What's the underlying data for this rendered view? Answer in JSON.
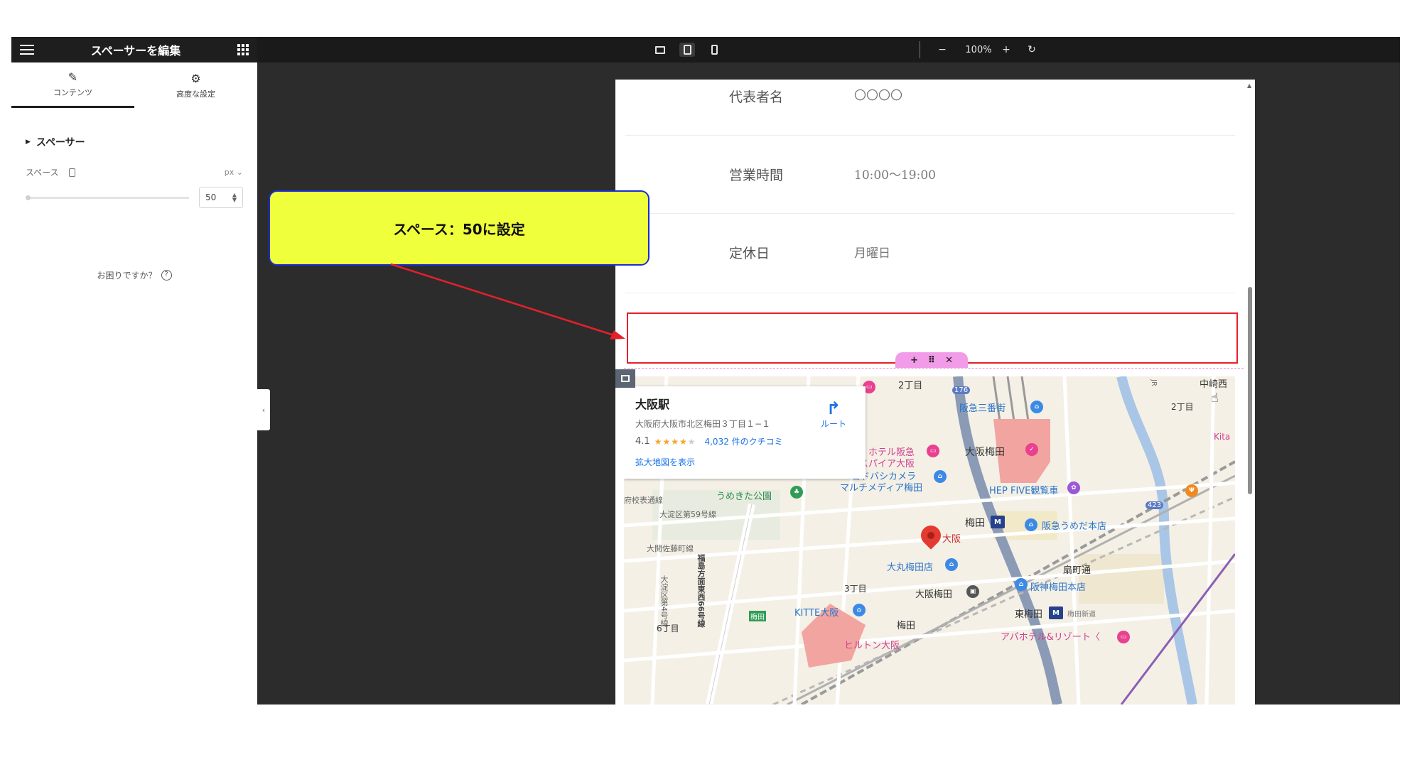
{
  "panel": {
    "title": "スペーサーを編集",
    "tabs": [
      {
        "label": "コンテンツ",
        "icon": "pencil-icon",
        "active": true
      },
      {
        "label": "高度な設定",
        "icon": "gear-icon",
        "active": false
      }
    ],
    "section_title": "スペーサー",
    "space_label": "スペース",
    "unit": "px",
    "space_value": "50",
    "help_text": "お困りですか？"
  },
  "toolbar": {
    "zoom": "100%",
    "devices": [
      "desktop",
      "tablet",
      "mobile"
    ],
    "active_device": "tablet"
  },
  "preview": {
    "rows": [
      {
        "label": "代表者名",
        "value": "〇〇〇〇"
      },
      {
        "label": "営業時間",
        "value": "10:00〜19:00"
      },
      {
        "label": "定休日",
        "value": "月曜日"
      }
    ]
  },
  "map": {
    "place_name": "大阪駅",
    "address": "大阪府大阪市北区梅田３丁目１−１",
    "rating": "4.1",
    "stars": "★★★★",
    "stars_empty": "★",
    "reviews": "4,032 件のクチコミ",
    "larger_map": "拡大地図を表示",
    "route_label": "ルート",
    "labels": {
      "hankyu_sanbangai": "阪急三番街",
      "osaka_umeda": "大阪梅田",
      "hotel_hankyu": "ホテル阪急",
      "respire_osaka": "レスパイア大阪",
      "yodobashi1": "ヨドバシカメラ",
      "yodobashi2": "マルチメディア梅田",
      "hep_five": "HEP FIVE観覧車",
      "umekita_park": "うめきた公園",
      "umeda": "梅田",
      "osaka": "大阪",
      "hankyu_umeda_honten": "阪急うめだ本店",
      "daimaru": "大丸梅田店",
      "ohgimachi": "扇町通",
      "hanshin_umeda": "阪神梅田本店",
      "kitte_osaka": "KITTE大阪",
      "osaka_umeda_station": "大阪梅田",
      "higashi_umeda": "東梅田",
      "umeda2": "梅田",
      "apa_hotel": "アパホテル&リゾート〈",
      "hilton": "ヒルトン大阪",
      "nakazaki_nishi": "中崎西",
      "nichome_top": "2丁目",
      "nichome_right": "2丁目",
      "sanchome": "3丁目",
      "rokuchome": "6丁目",
      "kita": "Kita",
      "jr_line": "JR",
      "highway": "福島方面東西66号線",
      "route_59": "大淀区第59号線",
      "route_bottom": "大開佐藤町線",
      "route_left": "府校表通線",
      "station_umeda_small": "梅田",
      "highway_423": "423",
      "highway_176": "176",
      "umeda_shindo": "梅田新道",
      "route_ubiquitous": "大淀区第4号線"
    }
  },
  "callout": {
    "text": "スペース：50に設定"
  },
  "colors": {
    "accent_callout": "#efff3c",
    "callout_border": "#1b2ed6",
    "highlight": "#e5202b",
    "spacer_handle": "#f29be8"
  }
}
